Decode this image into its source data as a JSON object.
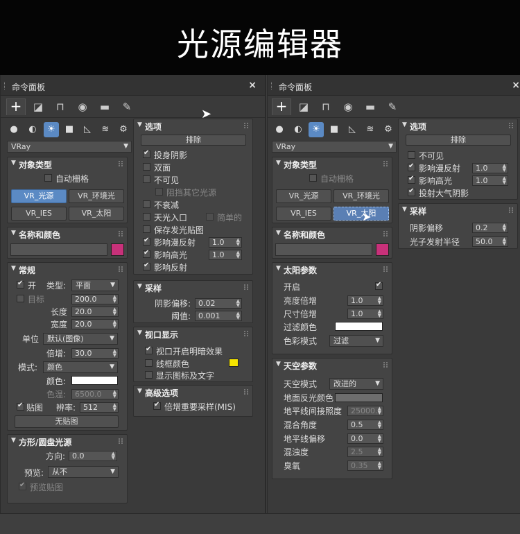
{
  "banner": {
    "title": "光源编辑器"
  },
  "panel": {
    "title": "命令面板",
    "close": "×",
    "renderer": "VRay"
  },
  "left": {
    "object_type": {
      "header": "对象类型",
      "autogrid": "自动栅格",
      "buttons": [
        "VR_光源",
        "VR_环境光",
        "VR_IES",
        "VR_太阳"
      ]
    },
    "name_color": {
      "header": "名称和颜色",
      "swatch": "#c8317a"
    },
    "general": {
      "header": "常规",
      "on": "开",
      "type_label": "类型:",
      "type_value": "平面",
      "target": "目标",
      "target_val": "200.0",
      "length_label": "长度",
      "length_val": "20.0",
      "width_label": "宽度",
      "width_val": "20.0",
      "unit_label": "单位",
      "unit_value": "默认(图像)",
      "mult_label": "倍增:",
      "mult_val": "30.0",
      "mode_label": "模式:",
      "mode_value": "颜色",
      "color_label": "颜色:",
      "temp_label": "色温:",
      "temp_val": "6500.0",
      "texture": "贴图",
      "res_label": "辨率:",
      "res_val": "512",
      "no_texture": "无贴图"
    },
    "shape": {
      "header": "方形/圆盘光源",
      "dir_label": "方向:",
      "dir_val": "0.0",
      "preview_label": "预览:",
      "preview_val": "从不",
      "preview_tex": "预览贴图"
    },
    "options": {
      "header": "选项",
      "exclude": "排除",
      "cast_shadow": "投身阴影",
      "double": "双面",
      "invisible": "不可见",
      "occlude": "阻挡其它光源",
      "no_decay": "不衰减",
      "skylight": "天光入口",
      "simple": "简单的",
      "store_irr": "保存发光贴图",
      "affect_diff": "影响漫反射",
      "affect_diff_val": "1.0",
      "affect_spec": "影响高光",
      "affect_spec_val": "1.0",
      "affect_refl": "影响反射"
    },
    "sampling": {
      "header": "采样",
      "bias_label": "阴影偏移:",
      "bias_val": "0.02",
      "cutoff_label": "阈值:",
      "cutoff_val": "0.001"
    },
    "viewport": {
      "header": "视口显示",
      "shading": "视口开启明暗效果",
      "wire_color": "线框颜色",
      "show_icon": "显示图标及文字"
    },
    "advanced": {
      "header": "高级选项",
      "mis": "倍增重要采样(MIS)"
    }
  },
  "right": {
    "object_type": {
      "header": "对象类型",
      "autogrid": "自动栅格",
      "buttons": [
        "VR_光源",
        "VR_环境光",
        "VR_IES",
        "VR_太阳"
      ]
    },
    "name_color": {
      "header": "名称和颜色",
      "swatch": "#c8317a"
    },
    "sun": {
      "header": "太阳参数",
      "enabled": "开启",
      "intensity_label": "亮度倍增",
      "intensity_val": "1.0",
      "size_label": "尺寸倍增",
      "size_val": "1.0",
      "filter_label": "过滤颜色",
      "colormode_label": "色彩模式",
      "colormode_val": "过滤"
    },
    "sky": {
      "header": "天空参数",
      "model_label": "天空模式",
      "model_val": "改进的",
      "ground_label": "地面反光颜色",
      "horiz_label": "地平线间接照度",
      "horiz_val": "25000.",
      "blend_label": "混合角度",
      "blend_val": "0.5",
      "hoff_label": "地平线偏移",
      "hoff_val": "0.0",
      "turb_label": "混浊度",
      "turb_val": "2.5",
      "ozone_label": "臭氧",
      "ozone_val": "0.35"
    },
    "options": {
      "header": "选项",
      "exclude": "排除",
      "invisible": "不可见",
      "affect_diff": "影响漫反射",
      "affect_diff_val": "1.0",
      "affect_spec": "影响高光",
      "affect_spec_val": "1.0",
      "atmos": "投射大气阴影"
    },
    "sampling": {
      "header": "采样",
      "bias_label": "阴影偏移",
      "bias_val": "0.2",
      "radius_label": "光子发射半径",
      "radius_val": "50.0"
    }
  }
}
